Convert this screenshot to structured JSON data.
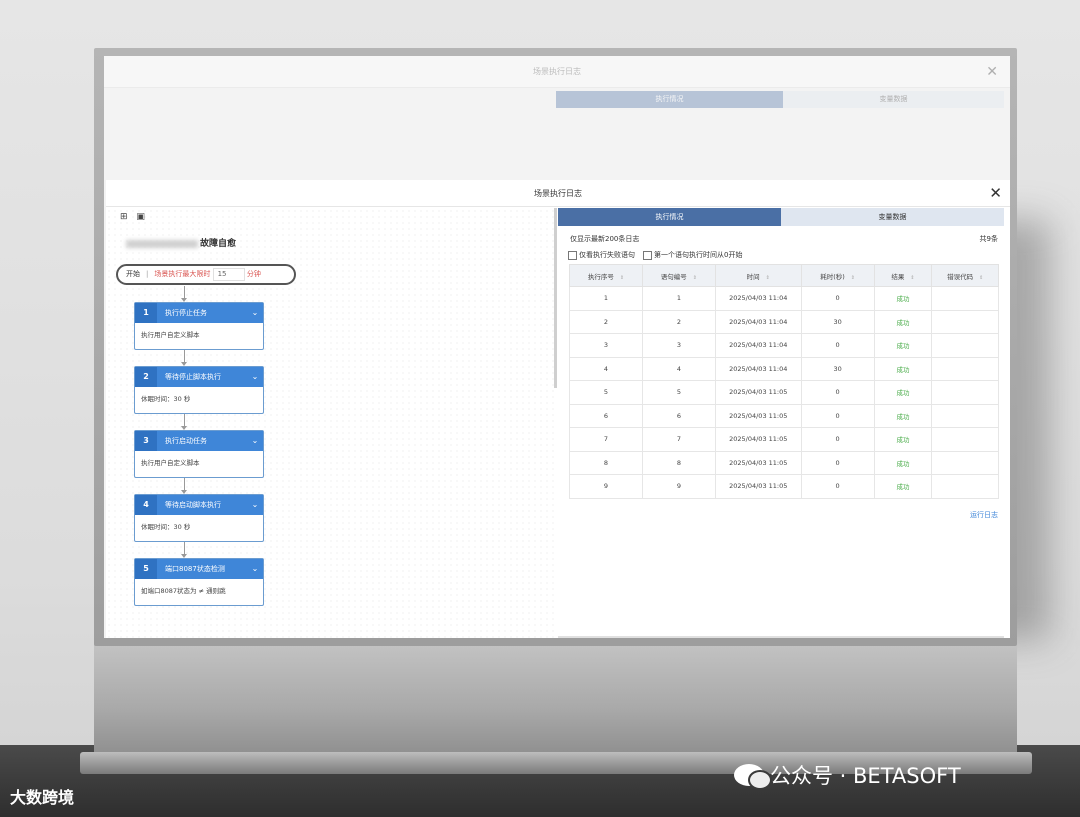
{
  "dialog": {
    "title": "场景执行日志",
    "close": "✕"
  },
  "left": {
    "tool_icons": [
      "⊞",
      "▣"
    ],
    "scene_name_suffix": "故障自愈",
    "start": {
      "start_label": "开始",
      "timeout_label": "场景执行最大限时",
      "timeout_value": "15",
      "timeout_unit": "分钟"
    },
    "steps": [
      {
        "num": "1",
        "title": "执行停止任务",
        "body": "执行用户自定义脚本"
      },
      {
        "num": "2",
        "title": "等待停止脚本执行",
        "body": "休眠时间：30 秒"
      },
      {
        "num": "3",
        "title": "执行启动任务",
        "body": "执行用户自定义脚本"
      },
      {
        "num": "4",
        "title": "等待启动脚本执行",
        "body": "休眠时间：30 秒"
      },
      {
        "num": "5",
        "title": "端口8087状态检测",
        "body": "如端口8087状态为 ≠ 通则跳"
      }
    ]
  },
  "right": {
    "tabs": [
      "执行情况",
      "变量数据"
    ],
    "info_text": "仅显示最新200条日志",
    "total": "共9条",
    "checkboxes": [
      "仅看执行失败语句",
      "第一个语句执行时间从0开始"
    ],
    "columns": [
      "执行序号",
      "语句编号",
      "时间",
      "耗时(秒)",
      "结果",
      "错误代码"
    ],
    "rows": [
      [
        "1",
        "1",
        "2025/04/03 11:04",
        "0",
        "成功",
        ""
      ],
      [
        "2",
        "2",
        "2025/04/03 11:04",
        "30",
        "成功",
        ""
      ],
      [
        "3",
        "3",
        "2025/04/03 11:04",
        "0",
        "成功",
        ""
      ],
      [
        "4",
        "4",
        "2025/04/03 11:04",
        "30",
        "成功",
        ""
      ],
      [
        "5",
        "5",
        "2025/04/03 11:05",
        "0",
        "成功",
        ""
      ],
      [
        "6",
        "6",
        "2025/04/03 11:05",
        "0",
        "成功",
        ""
      ],
      [
        "7",
        "7",
        "2025/04/03 11:05",
        "0",
        "成功",
        ""
      ],
      [
        "8",
        "8",
        "2025/04/03 11:05",
        "0",
        "成功",
        ""
      ],
      [
        "9",
        "9",
        "2025/04/03 11:05",
        "0",
        "成功",
        ""
      ]
    ],
    "run_log_link": "运行日志"
  },
  "watermarks": {
    "left": "大数跨境",
    "right": "公众号 · BETASOFT"
  },
  "colors": {
    "accent": "#4a6fa5",
    "step_blue": "#3f86d8",
    "success": "#4cae4c",
    "timeout_red": "#d9534f"
  }
}
